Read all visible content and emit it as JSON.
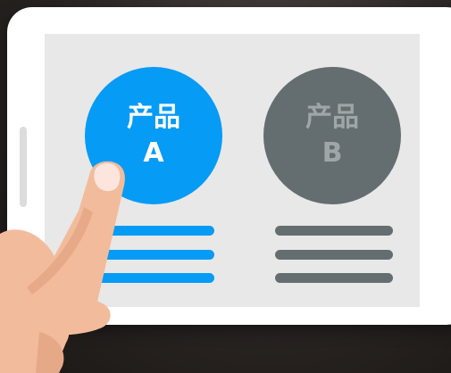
{
  "products": [
    {
      "line1": "产品",
      "line2": "A",
      "color": "#069bf5",
      "state": "selected",
      "detail_lines": 3
    },
    {
      "line1": "产品",
      "line2": "B",
      "color": "#646e70",
      "state": "unselected",
      "detail_lines": 3
    }
  ],
  "colors": {
    "accent": "#069bf5",
    "inactive": "#646e70",
    "screen_bg": "#e8e8e8",
    "device": "#ffffff",
    "skin": "#f2bc9c"
  },
  "icons": {
    "pointer": "hand-pointer-icon"
  }
}
